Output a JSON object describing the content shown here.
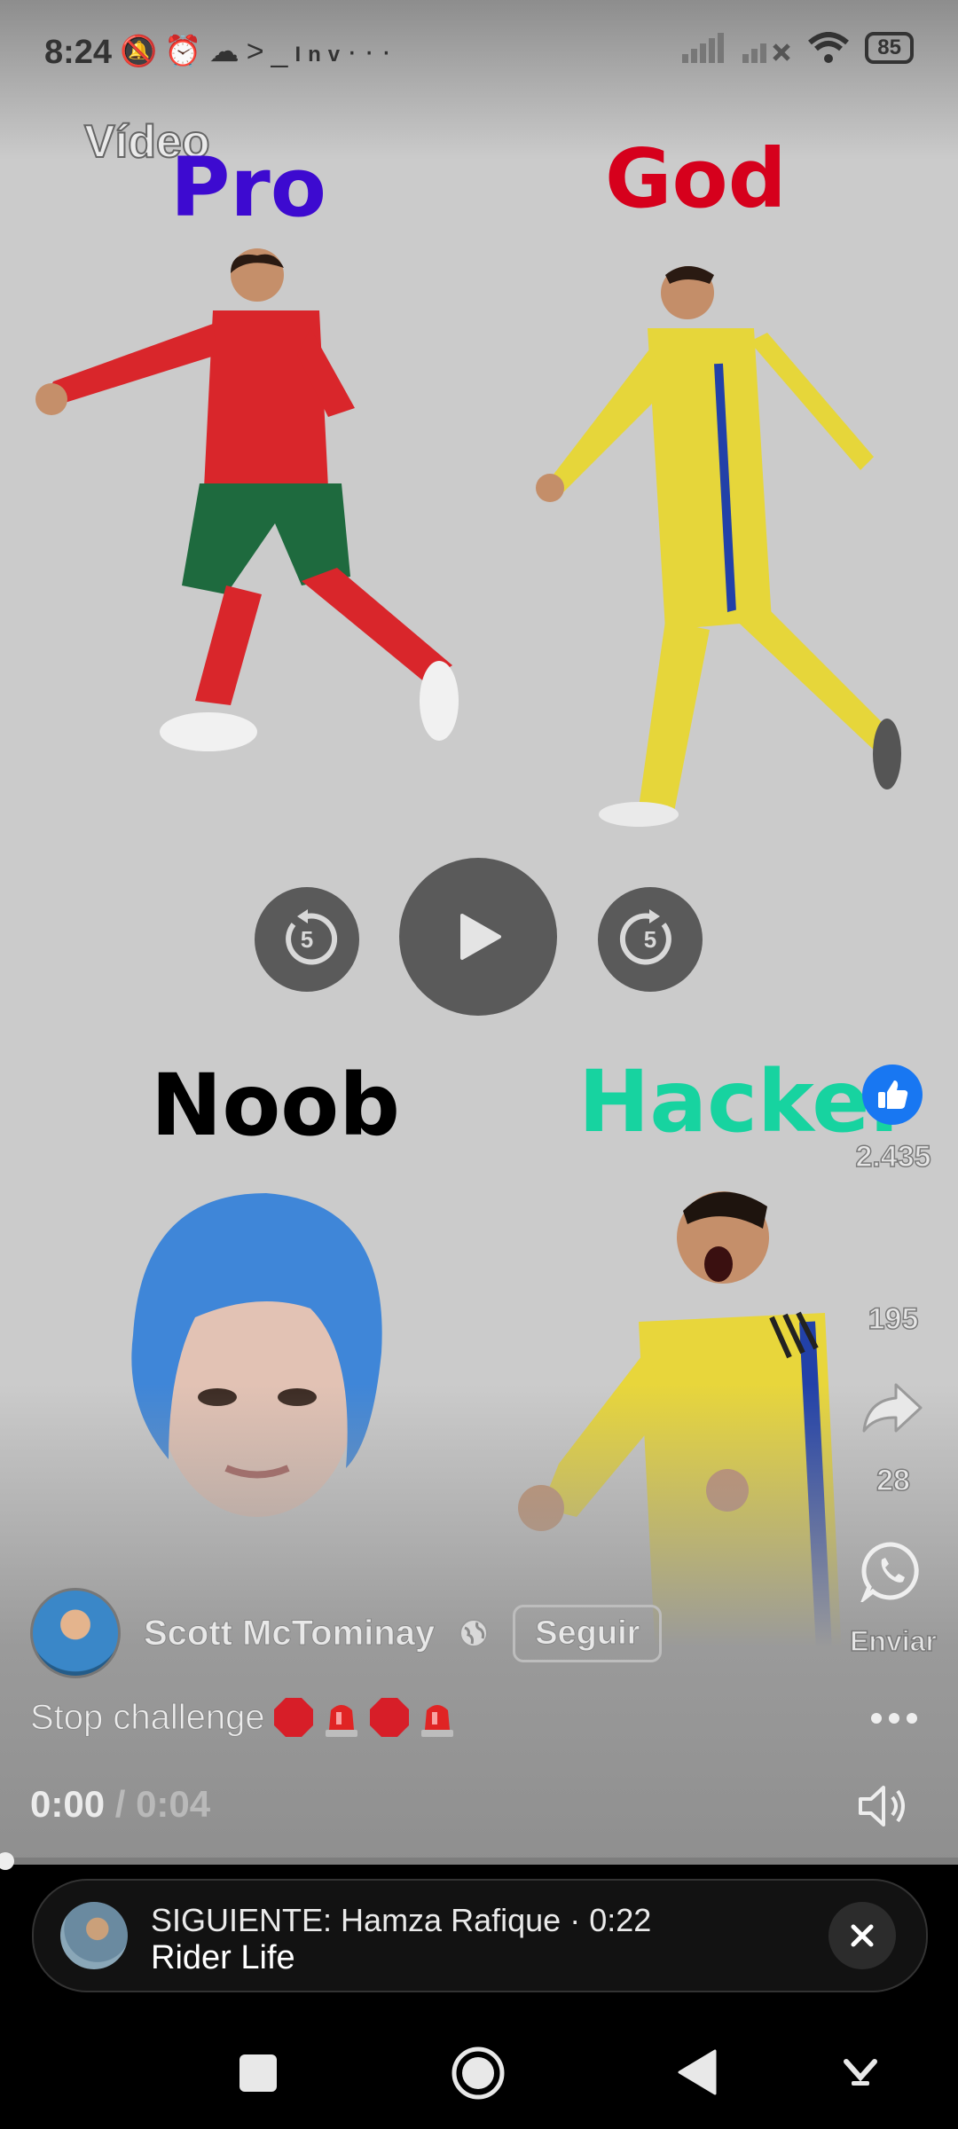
{
  "status_bar": {
    "time": "8:24",
    "notification_icons": [
      "bell-off-icon",
      "alarm-icon",
      "cloud-icon",
      "terminal-icon",
      "inv-icon",
      "more-dots-icon"
    ],
    "inv_label": "Inv",
    "battery": "85"
  },
  "video": {
    "label": "Vídeo",
    "quadrants": {
      "top_left": "Pro",
      "top_right": "God",
      "bottom_left": "Noob",
      "bottom_right": "Hacker"
    },
    "colors": {
      "pro": "#3d0ad0",
      "god": "#d6001c",
      "noob": "#000000",
      "hacker": "#17d3a0"
    }
  },
  "controls": {
    "rewind_seconds": "5",
    "forward_seconds": "5"
  },
  "side_actions": {
    "like_count": "2.435",
    "comment_count": "195",
    "share_count": "28",
    "send_label": "Enviar"
  },
  "author": {
    "name": "Scott McTominay",
    "follow_label": "Seguir"
  },
  "caption": {
    "text": "Stop challenge",
    "emojis": [
      "stop-sign-icon",
      "siren-icon",
      "stop-sign-icon",
      "siren-icon"
    ]
  },
  "playback": {
    "current": "0:00",
    "separator": "/",
    "duration": "0:04",
    "progress_fraction": 0
  },
  "up_next": {
    "prefix": "SIGUIENTE:",
    "channel": "Hamza Rafique",
    "dot": "·",
    "length": "0:22",
    "title": "Rider Life"
  }
}
